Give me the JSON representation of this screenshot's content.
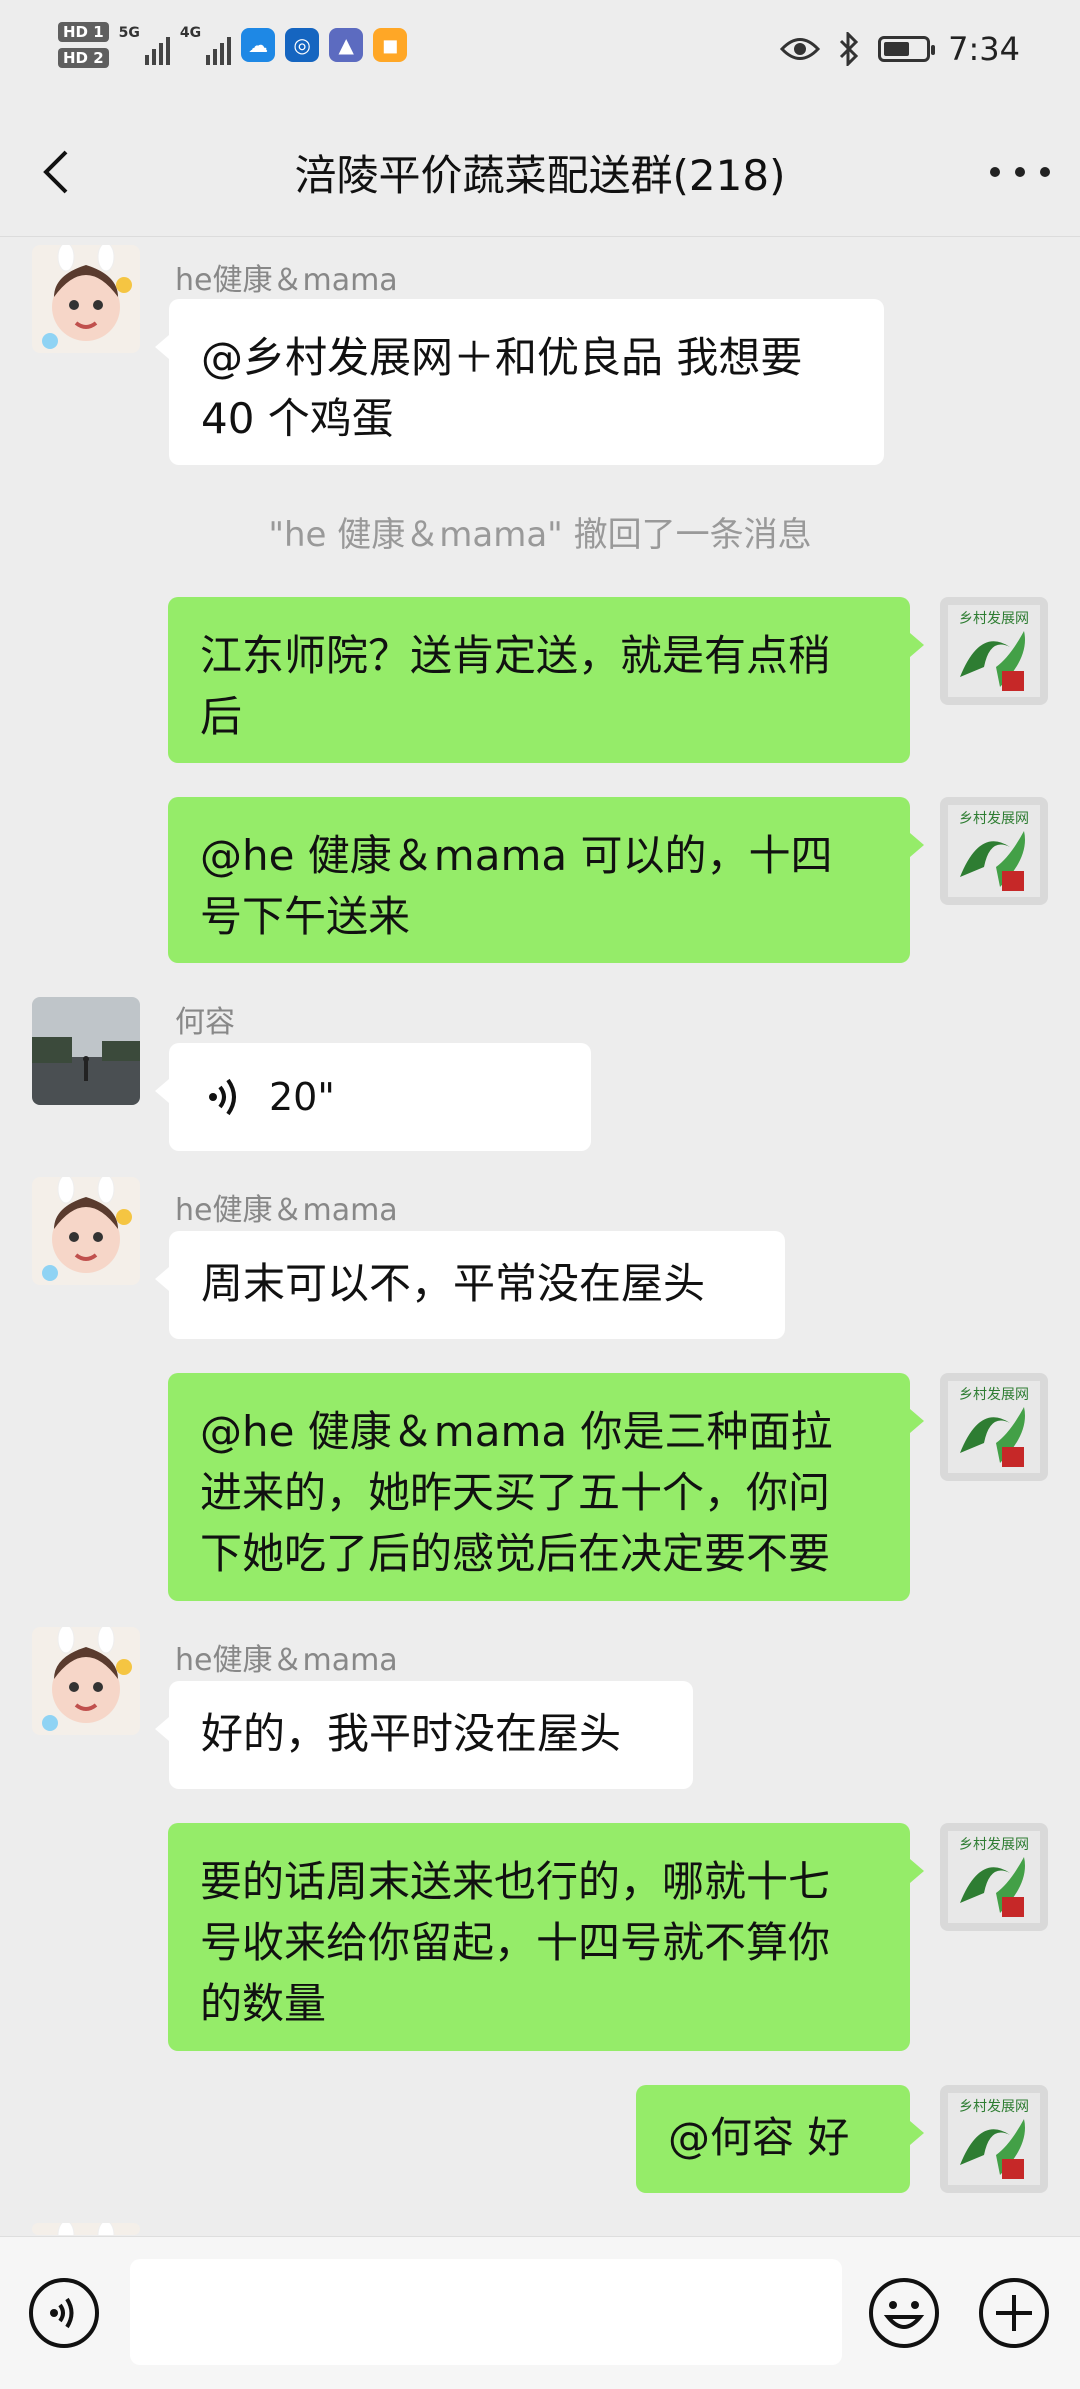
{
  "status_bar": {
    "hd1": "HD 1",
    "hd2": "HD 2",
    "net1": "5G",
    "net2": "4G",
    "time": "7:34"
  },
  "header": {
    "title": "涪陵平价蔬菜配送群(218)"
  },
  "messages": [
    {
      "sender": "he健康＆mama",
      "direction": "in",
      "text_lines": [
        "@乡村发展网＋和优良品 我想要",
        "40 个鸡蛋"
      ]
    },
    {
      "type": "system",
      "text": "\"he 健康＆mama\" 撤回了一条消息"
    },
    {
      "direction": "out",
      "text_lines": [
        "江东师院？送肯定送，就是有点稍",
        "后"
      ]
    },
    {
      "direction": "out",
      "text_lines": [
        "@he 健康＆mama  可以的，十四",
        "号下午送来"
      ]
    },
    {
      "sender": "何容",
      "direction": "in",
      "voice": "20\""
    },
    {
      "sender": "he健康＆mama",
      "direction": "in",
      "text_lines": [
        "周末可以不，平常没在屋头"
      ]
    },
    {
      "direction": "out",
      "text_lines": [
        "@he 健康＆mama  你是三种面拉",
        "进来的，她昨天买了五十个，你问",
        "下她吃了后的感觉后在决定要不要"
      ]
    },
    {
      "sender": "he健康＆mama",
      "direction": "in",
      "text_lines": [
        "好的，我平时没在屋头"
      ]
    },
    {
      "direction": "out",
      "text_lines": [
        "要的话周末送来也行的，哪就十七",
        "号收来给你留起，十四号就不算你",
        "的数量"
      ]
    },
    {
      "direction": "out",
      "text_lines": [
        "@何容  好"
      ]
    }
  ],
  "colors": {
    "background": "#ededed",
    "outgoing_bubble": "#95ec69",
    "incoming_bubble": "#ffffff"
  }
}
